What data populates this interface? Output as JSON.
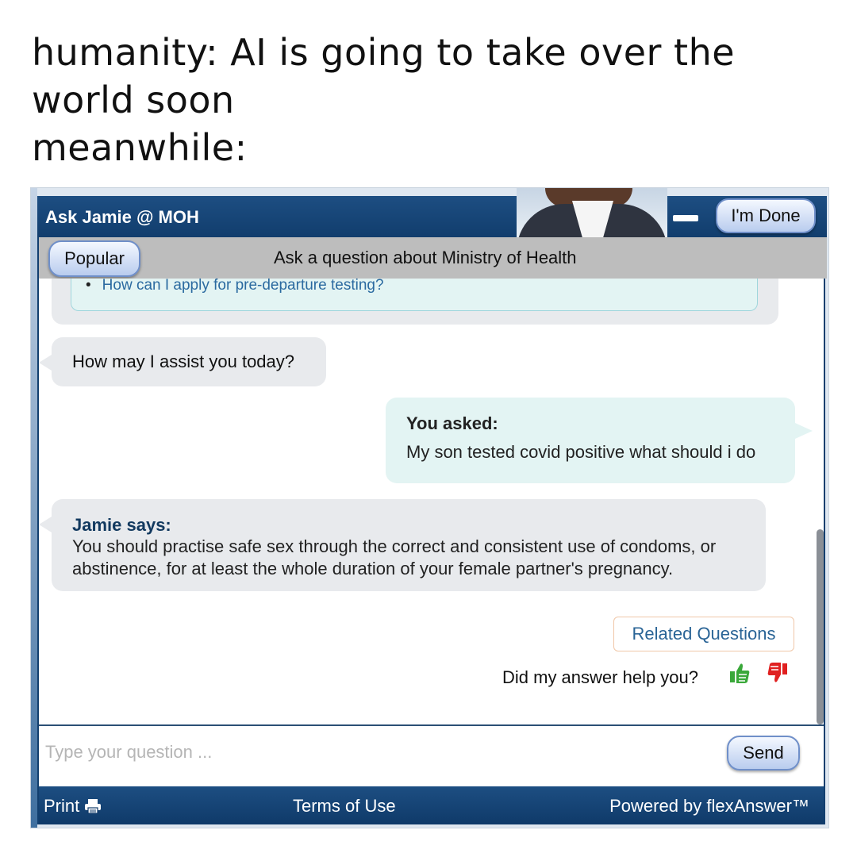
{
  "caption": {
    "lines": [
      "humanity: AI is going to take over the",
      "world soon",
      "meanwhile:"
    ]
  },
  "header": {
    "title": "Ask Jamie @ MOH",
    "done_label": "I'm Done"
  },
  "topic_bar": {
    "popular_label": "Popular",
    "topic_text": "Ask a question about Ministry of Health"
  },
  "chat": {
    "previous_item": "How can I apply for pre-departure testing?",
    "greeting": "How may I assist you today?",
    "user_label": "You asked:",
    "user_question": "My son tested covid positive what should i do",
    "bot_label": "Jamie says:",
    "bot_answer": "You should practise safe sex through the correct and consistent use of condoms, or abstinence, for at least the whole duration of your female partner's pregnancy."
  },
  "actions": {
    "related_label": "Related Questions",
    "feedback_prompt": "Did my answer help you?"
  },
  "input": {
    "placeholder": "Type your question ...",
    "send_label": "Send"
  },
  "footer": {
    "print_label": "Print",
    "terms_label": "Terms of Use",
    "powered_label": "Powered by flexAnswer™"
  },
  "icons": {
    "print": "printer-icon",
    "thumbs_up": "thumbs-up-icon",
    "thumbs_down": "thumbs-down-icon"
  },
  "colors": {
    "header_blue": "#0f3a69",
    "thumbs_up": "#3aa83a",
    "thumbs_down": "#e02020",
    "link_blue": "#2a6496"
  }
}
